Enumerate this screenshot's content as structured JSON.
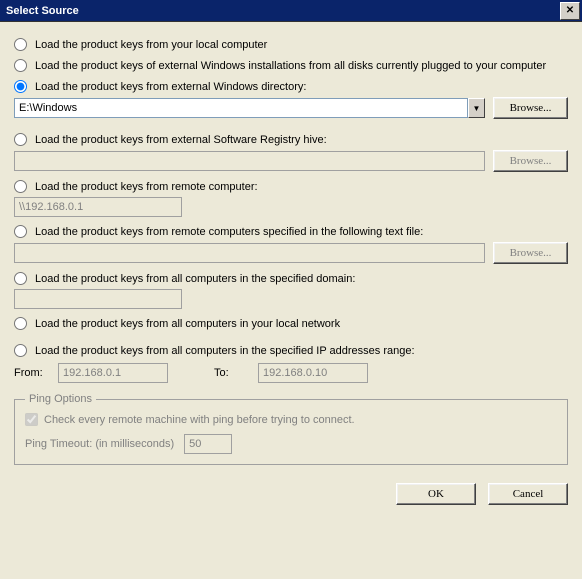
{
  "window": {
    "title": "Select Source"
  },
  "options": {
    "local": {
      "label": "Load the product keys from your local computer"
    },
    "allDisks": {
      "label": "Load the product keys of external Windows installations from all disks currently plugged to your computer"
    },
    "externalDir": {
      "label": "Load the product keys from external Windows directory:",
      "value": "E:\\Windows",
      "browse": "Browse..."
    },
    "registryHive": {
      "label": "Load the product keys from external Software Registry hive:",
      "value": "",
      "browse": "Browse..."
    },
    "remote": {
      "label": "Load the product keys from remote computer:",
      "value": "\\\\192.168.0.1"
    },
    "remoteFile": {
      "label": "Load the product keys from remote computers specified in the following text file:",
      "value": "",
      "browse": "Browse..."
    },
    "domain": {
      "label": "Load the product keys from all computers in the specified domain:",
      "value": ""
    },
    "localNet": {
      "label": "Load the product keys from all computers in your local network"
    },
    "ipRange": {
      "label": "Load the product keys from all computers in the specified IP addresses range:",
      "fromLabel": "From:",
      "fromValue": "192.168.0.1",
      "toLabel": "To:",
      "toValue": "192.168.0.10"
    }
  },
  "ping": {
    "legend": "Ping Options",
    "checkLabel": "Check every remote machine with ping before trying to connect.",
    "checked": true,
    "timeoutLabel": "Ping Timeout: (in milliseconds)",
    "timeoutValue": "50"
  },
  "footer": {
    "ok": "OK",
    "cancel": "Cancel"
  },
  "selected": "externalDir",
  "colors": {
    "titlebar": "#0a246a",
    "face": "#ece9d8"
  }
}
